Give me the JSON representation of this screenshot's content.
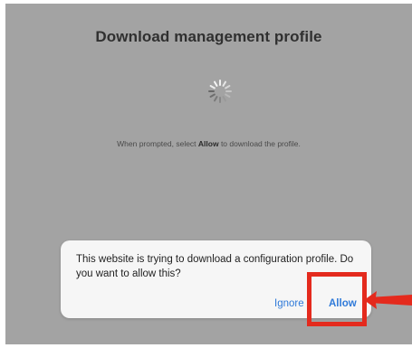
{
  "page": {
    "title": "Download management profile",
    "instruction_before": "When prompted, select ",
    "instruction_bold": "Allow",
    "instruction_after": " to download the profile."
  },
  "dialog": {
    "message": "This website is trying to download a configuration profile. Do you want to allow this?",
    "ignore_label": "Ignore",
    "allow_label": "Allow"
  },
  "icons": {
    "spinner": "loading-spinner-icon",
    "annotation": "red-arrow-pointer"
  },
  "colors": {
    "overlay_background": "#a3a3a3",
    "dialog_background": "#f6f6f6",
    "button_blue": "#2f7ad9",
    "annotation_red": "#e42a1d"
  }
}
